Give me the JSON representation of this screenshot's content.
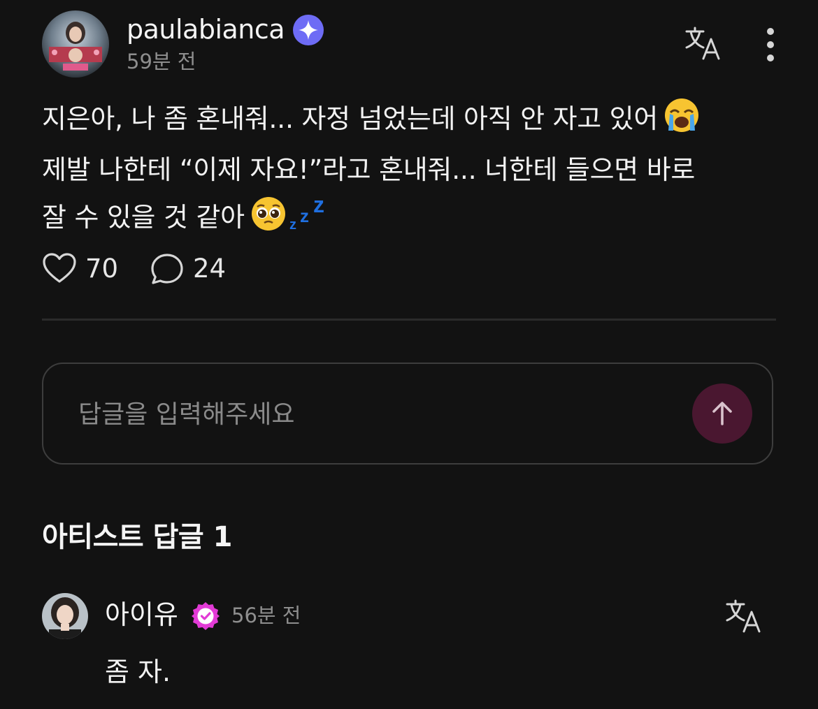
{
  "post": {
    "author": "paulabianca",
    "time": "59분 전",
    "lines": [
      "지은아, 나 좀 혼내줘... 자정 넘었는데 아직 안 자고 있어",
      "제발 나한테 “이제 자요!”라고 혼내줘... 너한테 들으면 바로",
      "잘 수 있을 것 같아"
    ],
    "emojis": [
      "loudly-crying-face",
      "pleading-face",
      "zzz"
    ],
    "likes": "70",
    "comments": "24"
  },
  "reply_box": {
    "placeholder": "답글을 입력해주세요"
  },
  "artist_replies": {
    "title": "아티스트 답글 1",
    "items": [
      {
        "author": "아이유",
        "time": "56분 전",
        "text": "좀 자."
      }
    ]
  },
  "icons": {
    "post_verified": "sparkle-verified-icon",
    "artist_verified": "check-verified-icon",
    "translate": "translate-icon",
    "more": "more-vertical-icon",
    "like": "heart-icon",
    "comment": "comment-bubble-icon",
    "send": "arrow-up-icon"
  },
  "colors": {
    "background": "#121212",
    "text_primary": "#f2f2f2",
    "text_secondary": "#8e8e8e",
    "verified_purple": "#6e6cf5",
    "verified_pink": "#e23bd6",
    "send_button": "#4a1730",
    "divider": "#2b2b2b"
  }
}
